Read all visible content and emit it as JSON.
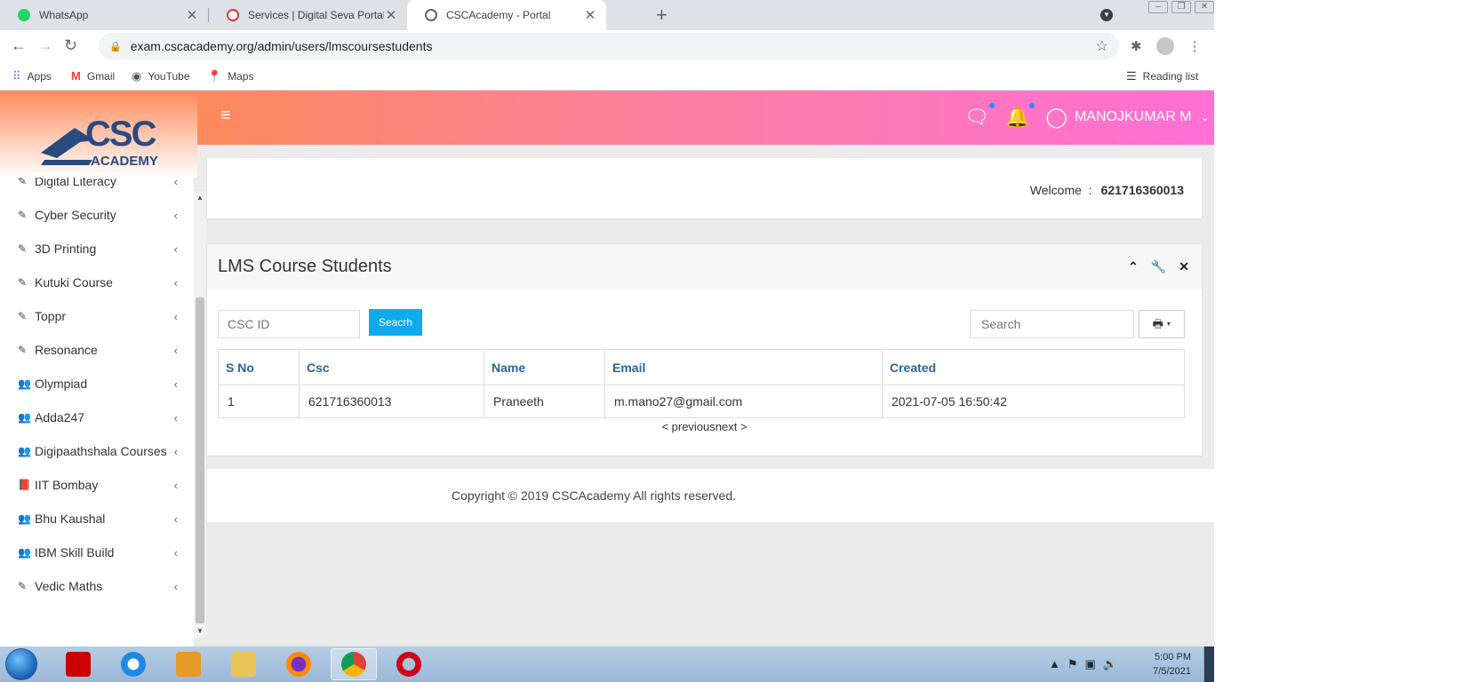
{
  "browser": {
    "tabs": [
      {
        "title": "WhatsApp",
        "icon": "whatsapp-icon",
        "active": false
      },
      {
        "title": "Services | Digital Seva Portal - CS",
        "icon": "digital-seva-icon",
        "active": false
      },
      {
        "title": "CSCAcademy - Portal",
        "icon": "globe-icon",
        "active": true
      }
    ],
    "url": "exam.cscacademy.org/admin/users/lmscoursestudents",
    "bookmarks": [
      {
        "label": "Apps",
        "icon": "apps-grid-icon"
      },
      {
        "label": "Gmail",
        "icon": "gmail-icon"
      },
      {
        "label": "YouTube",
        "icon": "youtube-icon"
      },
      {
        "label": "Maps",
        "icon": "maps-icon"
      }
    ],
    "reading_list": "Reading list"
  },
  "header": {
    "user_name": "MANOJKUMAR M",
    "logo_text_main": "CSC",
    "logo_text_sub": "ACADEMY"
  },
  "sidebar": {
    "items": [
      {
        "label": "Digital Literacy",
        "icon": "edit-icon"
      },
      {
        "label": "Cyber Security",
        "icon": "edit-icon"
      },
      {
        "label": "3D Printing",
        "icon": "edit-icon"
      },
      {
        "label": "Kutuki Course",
        "icon": "edit-icon"
      },
      {
        "label": "Toppr",
        "icon": "edit-icon"
      },
      {
        "label": "Resonance",
        "icon": "edit-icon"
      },
      {
        "label": "Olympiad",
        "icon": "users-icon"
      },
      {
        "label": "Adda247",
        "icon": "users-icon"
      },
      {
        "label": "Digipaathshala Courses",
        "icon": "users-icon"
      },
      {
        "label": "IIT Bombay",
        "icon": "book-icon"
      },
      {
        "label": "Bhu Kaushal",
        "icon": "users-icon"
      },
      {
        "label": "IBM Skill Build",
        "icon": "users-icon"
      },
      {
        "label": "Vedic Maths",
        "icon": "edit-icon"
      }
    ]
  },
  "welcome": {
    "label": "Welcome",
    "separator": ":",
    "user_id": "621716360013"
  },
  "panel": {
    "title": "LMS Course Students",
    "csc_placeholder": "CSC ID",
    "search_button": "Seacrh",
    "search_placeholder": "Search",
    "columns": [
      "S No",
      "Csc",
      "Name",
      "Email",
      "Created"
    ],
    "rows": [
      [
        "1",
        "621716360013",
        "Praneeth",
        "m.mano27@gmail.com",
        "2021-07-05 16:50:42"
      ]
    ],
    "pager_prev": "< previous",
    "pager_next": "next >"
  },
  "footer": {
    "copyright": "Copyright © 2019 CSCAcademy All rights reserved."
  },
  "taskbar": {
    "time": "5:00 PM",
    "date": "7/5/2021",
    "apps": [
      "acrobat",
      "internet-explorer",
      "media-player",
      "file-explorer",
      "firefox",
      "chrome",
      "opera"
    ]
  }
}
